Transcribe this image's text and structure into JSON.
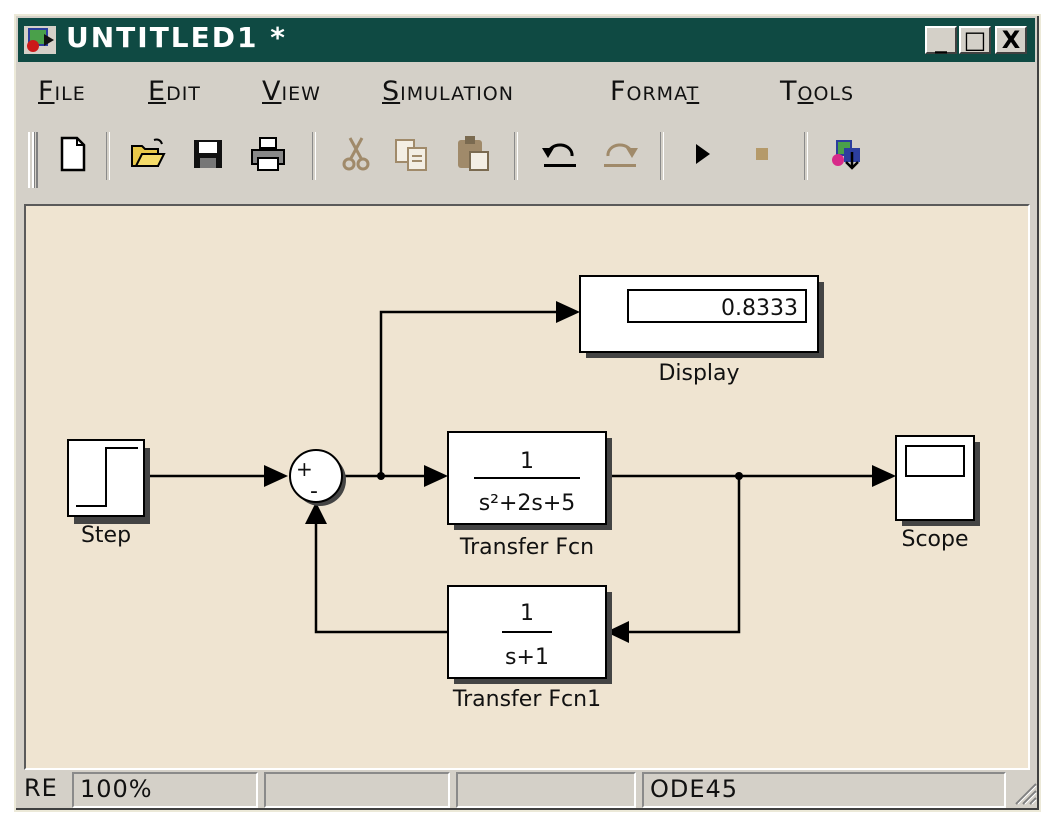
{
  "window": {
    "title": "UNTITLED1 *",
    "minimize_label": "_",
    "maximize_label": "□",
    "close_label": "X"
  },
  "menu": [
    {
      "label": "File",
      "access": "F",
      "rest": "ile"
    },
    {
      "label": "Edit",
      "access": "E",
      "rest": "dit"
    },
    {
      "label": "View",
      "access": "V",
      "rest": "iew"
    },
    {
      "label": "Simulation",
      "access": "S",
      "rest": "imulation"
    },
    {
      "label": "Format",
      "pre": "Forma",
      "access": "t"
    },
    {
      "label": "Tools",
      "pre": "T",
      "access": "o",
      "rest": "ols"
    }
  ],
  "toolbar": [
    {
      "icon": "new-document-icon",
      "enabled": true
    },
    {
      "icon": "open-folder-icon",
      "enabled": true
    },
    {
      "icon": "save-icon",
      "enabled": true
    },
    {
      "icon": "print-icon",
      "enabled": true
    },
    {
      "icon": "cut-icon",
      "enabled": false
    },
    {
      "icon": "copy-icon",
      "enabled": false
    },
    {
      "icon": "paste-icon",
      "enabled": false
    },
    {
      "icon": "undo-icon",
      "enabled": true
    },
    {
      "icon": "redo-icon",
      "enabled": false
    },
    {
      "icon": "start-simulation-icon",
      "enabled": true
    },
    {
      "icon": "stop-simulation-icon",
      "enabled": false
    },
    {
      "icon": "library-browser-icon",
      "enabled": true
    }
  ],
  "diagram": {
    "blocks": {
      "step": {
        "label": "Step"
      },
      "sum": {
        "plus": "+",
        "minus": "-"
      },
      "display": {
        "label": "Display",
        "value": "0.8333"
      },
      "transfer_fcn": {
        "label": "Transfer Fcn",
        "numerator": "1",
        "denominator": "s²+2s+5"
      },
      "transfer_fcn1": {
        "label": "Transfer Fcn1",
        "numerator": "1",
        "denominator": "s+1"
      },
      "scope": {
        "label": "Scope"
      }
    }
  },
  "status": {
    "state": "RE",
    "zoom": "100%",
    "pane2": "",
    "pane3": "",
    "solver": "ODE45"
  },
  "colors": {
    "titlebar": "#0f4a43",
    "canvas": "#efe4d1",
    "chrome": "#d4d0c8"
  }
}
